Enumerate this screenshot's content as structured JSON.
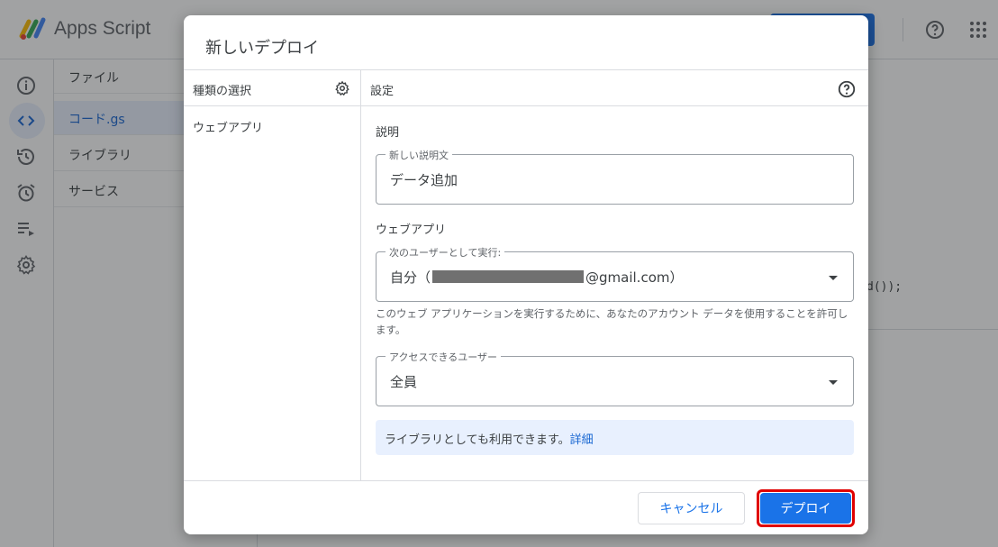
{
  "app": {
    "title": "Apps Script",
    "files": [
      {
        "label": "ファイル"
      },
      {
        "label": "コード.gs"
      },
      {
        "label": "ライブラリ"
      },
      {
        "label": "サービス"
      }
    ],
    "editor_snippet": "d());"
  },
  "dialog": {
    "title": "新しいデプロイ",
    "type_panel": {
      "header": "種類の選択",
      "items": [
        "ウェブアプリ"
      ]
    },
    "settings_panel": {
      "header": "設定",
      "description_section": "説明",
      "description_field": {
        "label": "新しい説明文",
        "value": "データ追加"
      },
      "webapp_section": "ウェブアプリ",
      "execute_as": {
        "label": "次のユーザーとして実行:",
        "value_prefix": "自分（",
        "value_suffix": "@gmail.com）"
      },
      "execute_hint": "このウェブ アプリケーションを実行するために、あなたのアカウント データを使用することを許可します。",
      "access": {
        "label": "アクセスできるユーザー",
        "value": "全員"
      },
      "info_text": "ライブラリとしても利用できます。",
      "info_link": "詳細"
    },
    "buttons": {
      "cancel": "キャンセル",
      "deploy": "デプロイ"
    }
  },
  "colors": {
    "primary": "#1a73e8",
    "highlight_outline": "#e00000",
    "info_bg": "#e8f0fe"
  }
}
